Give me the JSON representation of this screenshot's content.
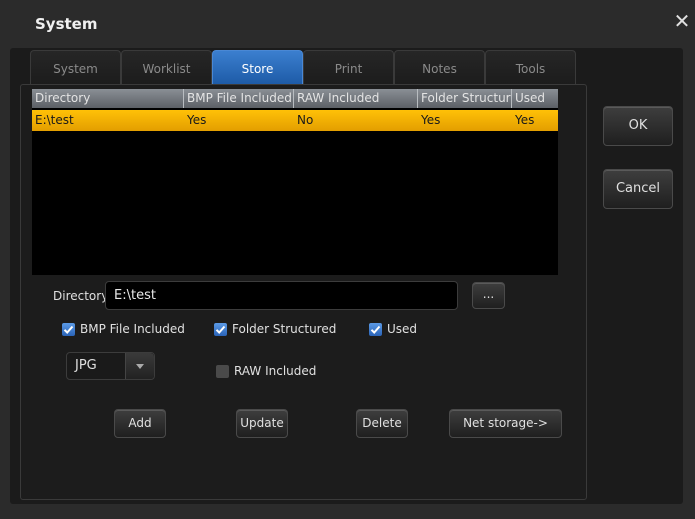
{
  "window": {
    "title": "System",
    "close_glyph": "✕"
  },
  "tabs": [
    {
      "label": "System"
    },
    {
      "label": "Worklist"
    },
    {
      "label": "Store",
      "active": true
    },
    {
      "label": "Print"
    },
    {
      "label": "Notes"
    },
    {
      "label": "Tools"
    }
  ],
  "table": {
    "columns": [
      "Directory",
      "BMP File Included",
      "RAW Included",
      "Folder Structured",
      "Used"
    ],
    "rows": [
      {
        "directory": "E:\\test",
        "bmp": "Yes",
        "raw": "No",
        "folder": "Yes",
        "used": "Yes",
        "selected": true
      }
    ]
  },
  "directory": {
    "label": "Directory",
    "value": "E:\\test",
    "browse_label": "..."
  },
  "checkboxes": {
    "bmp": {
      "label": "BMP File Included",
      "checked": true
    },
    "folder": {
      "label": "Folder Structured",
      "checked": true
    },
    "used": {
      "label": "Used",
      "checked": true
    },
    "raw": {
      "label": "RAW Included",
      "checked": false
    }
  },
  "format_select": {
    "value": "JPG"
  },
  "buttons": {
    "add": "Add",
    "update": "Update",
    "delete": "Delete",
    "net_storage": "Net storage->",
    "ok": "OK",
    "cancel": "Cancel"
  },
  "colors": {
    "selection": "#ffc107",
    "accent": "#2a6fc9"
  }
}
